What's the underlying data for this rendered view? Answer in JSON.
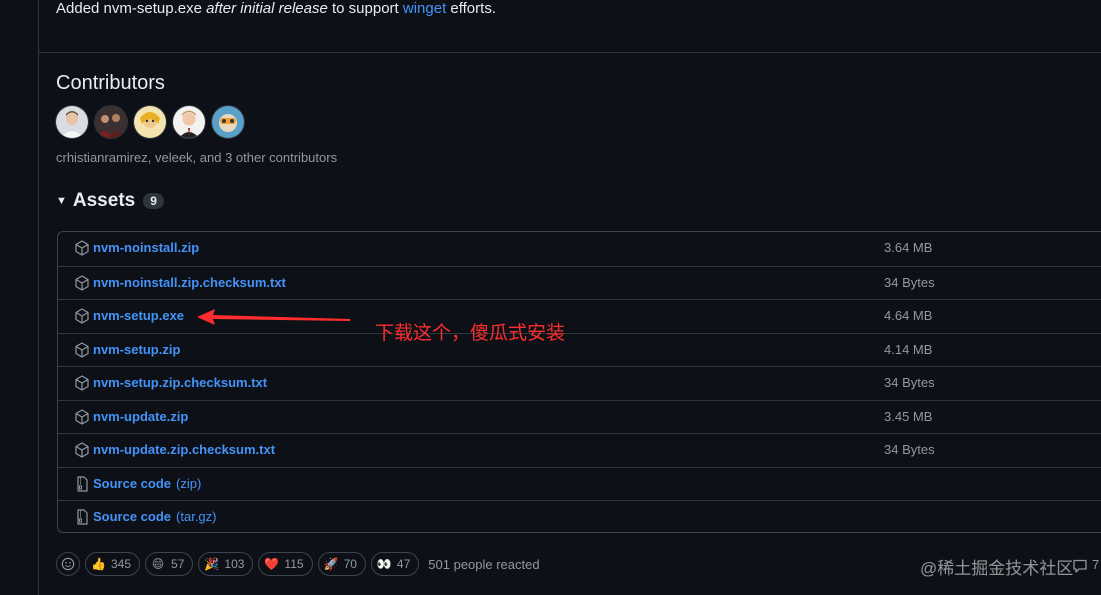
{
  "release_notes": {
    "prefix": "Added nvm-setup.exe ",
    "emphasis": "after initial release",
    "middle": " to support ",
    "link": "winget",
    "suffix": " efforts."
  },
  "contributors": {
    "title": "Contributors",
    "caption": "crhistianramirez, veleek, and 3 other contributors"
  },
  "assets": {
    "title": "Assets",
    "count": "9",
    "items": [
      {
        "name": "nvm-noinstall.zip",
        "suffix": "",
        "size": "3.64 MB",
        "icon": "package-icon"
      },
      {
        "name": "nvm-noinstall.zip.checksum.txt",
        "suffix": "",
        "size": "34 Bytes",
        "icon": "package-icon"
      },
      {
        "name": "nvm-setup.exe",
        "suffix": "",
        "size": "4.64 MB",
        "icon": "package-icon"
      },
      {
        "name": "nvm-setup.zip",
        "suffix": "",
        "size": "4.14 MB",
        "icon": "package-icon"
      },
      {
        "name": "nvm-setup.zip.checksum.txt",
        "suffix": "",
        "size": "34 Bytes",
        "icon": "package-icon"
      },
      {
        "name": "nvm-update.zip",
        "suffix": "",
        "size": "3.45 MB",
        "icon": "package-icon"
      },
      {
        "name": "nvm-update.zip.checksum.txt",
        "suffix": "",
        "size": "34 Bytes",
        "icon": "package-icon"
      },
      {
        "name": "Source code",
        "suffix": "(zip)",
        "size": "",
        "icon": "file-zip-icon"
      },
      {
        "name": "Source code",
        "suffix": "(tar.gz)",
        "size": "",
        "icon": "file-zip-icon"
      }
    ]
  },
  "annotation": {
    "text": "下载这个，傻瓜式安装"
  },
  "reactions": {
    "items": [
      {
        "emoji": "👍",
        "count": "345"
      },
      {
        "emoji": "😄",
        "count": "57"
      },
      {
        "emoji": "🎉",
        "count": "103"
      },
      {
        "emoji": "❤️",
        "count": "115"
      },
      {
        "emoji": "🚀",
        "count": "70"
      },
      {
        "emoji": "👀",
        "count": "47"
      }
    ],
    "summary": "501 people reacted"
  },
  "watermark": "@稀土掘金技术社区",
  "comments": {
    "count": "7"
  },
  "colors": {
    "background": "#0d1117",
    "link": "#4493f8",
    "muted": "#9198a1",
    "border": "#30363d",
    "annotation": "#ff2d2d"
  }
}
